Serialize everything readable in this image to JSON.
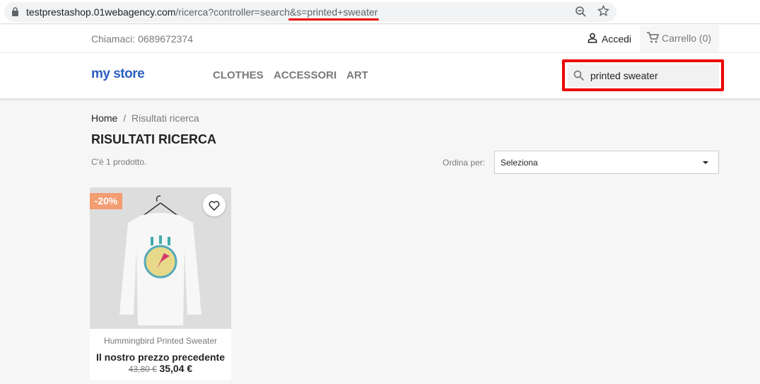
{
  "browser": {
    "url_host": "testprestashop.01webagency.com",
    "url_path": "/ricerca?controller=search",
    "url_query": "&s=printed+sweater",
    "highlight_color": "#ee0000"
  },
  "topbar": {
    "contact": "Chiamaci: 0689672374",
    "login": "Accedi",
    "cart": "Carrello (0)"
  },
  "header": {
    "logo": "my store",
    "nav": [
      "CLOTHES",
      "ACCESSORI",
      "ART"
    ],
    "search_value": "printed sweater"
  },
  "breadcrumb": {
    "home": "Home",
    "separator": "/",
    "current": "Risultati ricerca"
  },
  "page_title": "RISULTATI RICERCA",
  "count": "C'è 1 prodotto.",
  "sort": {
    "label": "Ordina per:",
    "value": "Seleziona"
  },
  "products": [
    {
      "name": "Hummingbird Printed Sweater",
      "badge": "-20%",
      "price_label": "Il nostro prezzo precedente",
      "old_price": "43,80 €",
      "price": "35,04 €",
      "badge_color": "#f39d72"
    }
  ]
}
